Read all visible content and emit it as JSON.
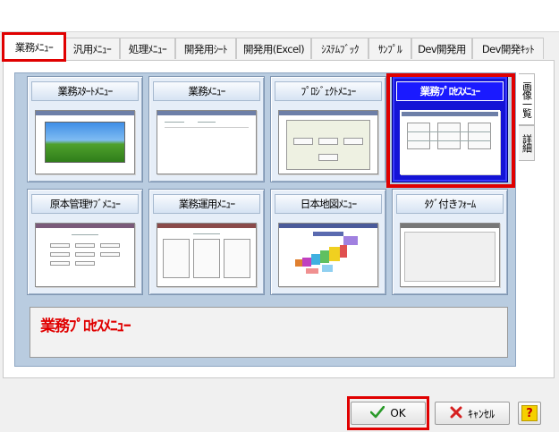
{
  "tabs": [
    {
      "label": "業務ﾒﾆｭｰ",
      "active": true
    },
    {
      "label": "汎用ﾒﾆｭｰ"
    },
    {
      "label": "処理ﾒﾆｭｰ"
    },
    {
      "label": "開発用ｼｰﾄ"
    },
    {
      "label": "開発用(Excel)"
    },
    {
      "label": "ｼｽﾃﾑﾌﾞｯｸ"
    },
    {
      "label": "ｻﾝﾌﾟﾙ"
    },
    {
      "label": "Dev開発用"
    },
    {
      "label": "Dev開発ｷｯﾄ"
    }
  ],
  "tiles": [
    {
      "label": "業務ｽﾀｰﾄﾒﾆｭｰ"
    },
    {
      "label": "業務ﾒﾆｭｰ"
    },
    {
      "label": "ﾌﾟﾛｼﾞｪｸﾄﾒﾆｭｰ"
    },
    {
      "label": "業務ﾌﾟﾛｾｽﾒﾆｭｰ",
      "selected": true
    },
    {
      "label": "原本管理ｻﾌﾞﾒﾆｭｰ"
    },
    {
      "label": "業務運用ﾒﾆｭｰ"
    },
    {
      "label": "日本地図ﾒﾆｭｰ"
    },
    {
      "label": "ﾀｸﾞ付きﾌｫｰﾑ"
    }
  ],
  "side_tabs": [
    {
      "label": "画像一覧",
      "active": true
    },
    {
      "label": "詳細"
    }
  ],
  "description": "業務ﾌﾟﾛｾｽﾒﾆｭｰ",
  "buttons": {
    "ok": "OK",
    "cancel": "ｷｬﾝｾﾙ",
    "help": "?"
  },
  "colors": {
    "highlight": "#e00000",
    "selected_tile": "#1313d6",
    "frame": "#b9cce0"
  },
  "icons": {
    "ok": "checkmark-icon",
    "cancel": "x-icon",
    "help": "help-icon"
  }
}
